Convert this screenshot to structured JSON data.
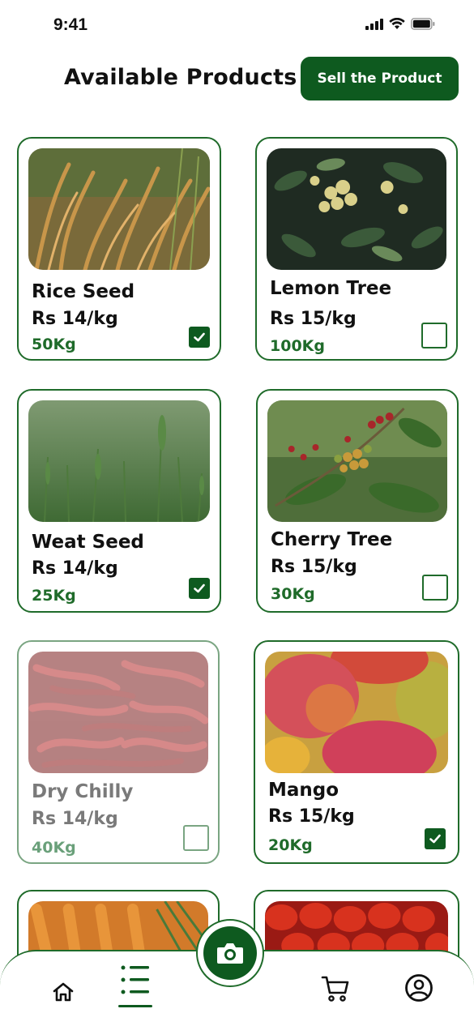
{
  "status_bar": {
    "time": "9:41"
  },
  "header": {
    "title": "Available Products",
    "sell_button": "Sell the Product"
  },
  "products": [
    {
      "name": "Rice Seed",
      "price": "Rs 14/kg",
      "quantity": "50Kg",
      "selected": true,
      "available": true
    },
    {
      "name": "Lemon Tree",
      "price": "Rs 15/kg",
      "quantity": "100Kg",
      "selected": false,
      "available": true
    },
    {
      "name": "Weat Seed",
      "price": "Rs 14/kg",
      "quantity": "25Kg",
      "selected": true,
      "available": true
    },
    {
      "name": "Cherry Tree",
      "price": "Rs 15/kg",
      "quantity": "30Kg",
      "selected": false,
      "available": true
    },
    {
      "name": "Dry Chilly",
      "price": "Rs 14/kg",
      "quantity": "40Kg",
      "selected": false,
      "available": false
    },
    {
      "name": "Mango",
      "price": "Rs 15/kg",
      "quantity": "20Kg",
      "selected": true,
      "available": true
    },
    {
      "name": "",
      "price": "",
      "quantity": ""
    },
    {
      "name": "",
      "price": "",
      "quantity": ""
    }
  ],
  "product_images": [
    "rice-seed-photo",
    "lemon-tree-photo",
    "wheat-seed-photo",
    "cherry-tree-photo",
    "dry-chilly-photo",
    "mango-photo",
    "carrot-photo",
    "tomato-photo"
  ],
  "bottom_nav": {
    "items": [
      "home-icon",
      "list-icon",
      "camera-icon",
      "cart-icon",
      "profile-icon"
    ],
    "active": "list-icon"
  },
  "colors": {
    "primary": "#0e5a1f",
    "border": "#1f6b2a",
    "quantity": "#1f6b2a",
    "faded_border": "#7aa582"
  }
}
